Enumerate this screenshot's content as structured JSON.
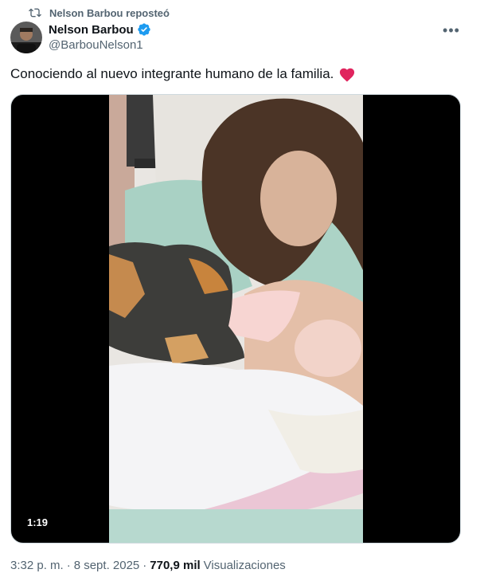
{
  "repost": {
    "label": "Nelson Barbou reposteó"
  },
  "author": {
    "name": "Nelson Barbou",
    "handle": "@BarbouNelson1"
  },
  "tweet": {
    "text": "Conociendo al nuevo integrante humano de la familia.",
    "emoji": "red-heart"
  },
  "media": {
    "duration": "1:19"
  },
  "meta": {
    "time": "3:32 p. m.",
    "separator": "·",
    "date": "8 sept. 2025",
    "separator2": "·",
    "views_count": "770,9 mil",
    "views_label": "Visualizaciones"
  },
  "colors": {
    "secondary_text": "#536471",
    "verified_blue": "#1d9bf0",
    "heart_red": "#f91880"
  }
}
